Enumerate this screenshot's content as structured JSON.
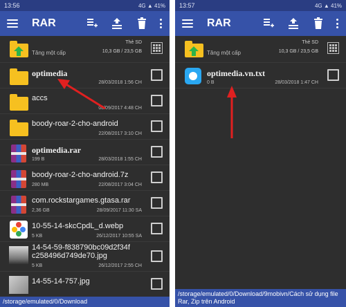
{
  "left": {
    "status_time": "13:56",
    "status_icons": "4G ▲ 41%",
    "app_title": "RAR",
    "up": {
      "label": "Tăng một cấp",
      "storage": "Thẻ SD",
      "space": "10,3 GB / 23,5 GB"
    },
    "items": [
      {
        "name": "optimedia",
        "size": "",
        "date": "28/03/2018 1:56 CH",
        "icon": "folder-icon"
      },
      {
        "name": "accs",
        "size": "",
        "date": "08/09/2017 4:48 CH",
        "icon": "folder-icon"
      },
      {
        "name": "boody-roar-2-cho-android",
        "size": "",
        "date": "22/08/2017 3:10 CH",
        "icon": "folder-icon"
      },
      {
        "name": "optimedia.rar",
        "size": "199 B",
        "date": "28/03/2018 1:55 CH",
        "icon": "rar-archive-icon"
      },
      {
        "name": "boody-roar-2-cho-android.7z",
        "size": "280 MB",
        "date": "22/08/2017 3:04 CH",
        "icon": "rar-archive-icon"
      },
      {
        "name": "com.rockstargames.gtasa.rar",
        "size": "2,36 GB",
        "date": "28/09/2017 11:30 SA",
        "icon": "rar-archive-icon"
      },
      {
        "name": "10-55-14-skcCpdL_d.webp",
        "size": "5 KB",
        "date": "26/12/2017 10:55 SA",
        "icon": "photos-app-icon"
      },
      {
        "name": "14-54-59-f838790bc09d2f34f",
        "name2": "c258496d749de70.jpg",
        "size": "5 KB",
        "date": "26/12/2017 2:55 CH",
        "icon": "image-thumbnail-icon"
      },
      {
        "name": "14-55-14-757.jpg",
        "size": "",
        "date": "",
        "icon": "image-thumbnail-icon"
      }
    ],
    "path": "/storage/emulated/0/Download"
  },
  "right": {
    "status_time": "13:57",
    "status_icons": "4G ▲ 41%",
    "app_title": "RAR",
    "up": {
      "label": "Tăng một cấp",
      "storage": "Thẻ SD",
      "space": "10,3 GB / 23,5 GB"
    },
    "items": [
      {
        "name": "optimedia.vn.txt",
        "size": "0 B",
        "date": "28/03/2018 1:47 CH",
        "icon": "text-file-icon"
      }
    ],
    "path": "/storage/emulated/0/Download/9mobivn/Cách sử dụng file Rar, Zip trên Android"
  },
  "colors": {
    "appbar": "#3652a8",
    "statusbar": "#2a3d82",
    "background": "#2e2e2e",
    "folder": "#f6c020",
    "arrow": "#e02020"
  }
}
